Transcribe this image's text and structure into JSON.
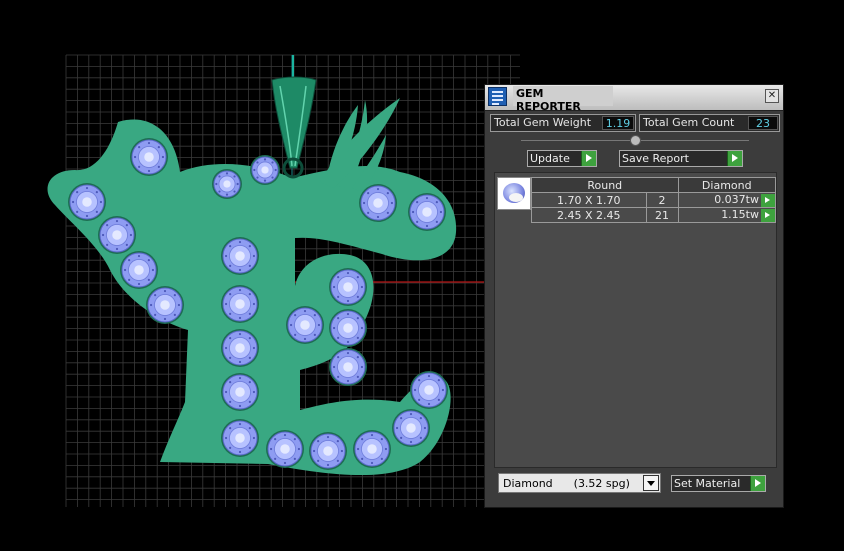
{
  "panel": {
    "title": "GEM REPORTER",
    "close_glyph": "✕",
    "stats": {
      "total_weight_label": "Total Gem Weight",
      "total_weight_value": "1.19",
      "total_count_label": "Total Gem Count",
      "total_count_value": "23"
    },
    "slider": {
      "level": 0.5
    },
    "update_label": "Update",
    "save_report_label": "Save Report",
    "gem_table": {
      "header_shape": "Round",
      "header_material": "Diamond",
      "rows": [
        {
          "size": "1.70 X 1.70",
          "count": "2",
          "weight": "0.037tw"
        },
        {
          "size": "2.45 X 2.45",
          "count": "21",
          "weight": "1.15tw"
        }
      ]
    },
    "material_select": {
      "selected": "Diamond      (3.52 spg)"
    },
    "set_material_label": "Set Material"
  },
  "viewport": {
    "model_color": "#39a882",
    "gem_color": "#8e9cf2",
    "bail_color": "#1e8a66",
    "grid_color": "#3a3a3a",
    "axis_color": "#b31414"
  }
}
